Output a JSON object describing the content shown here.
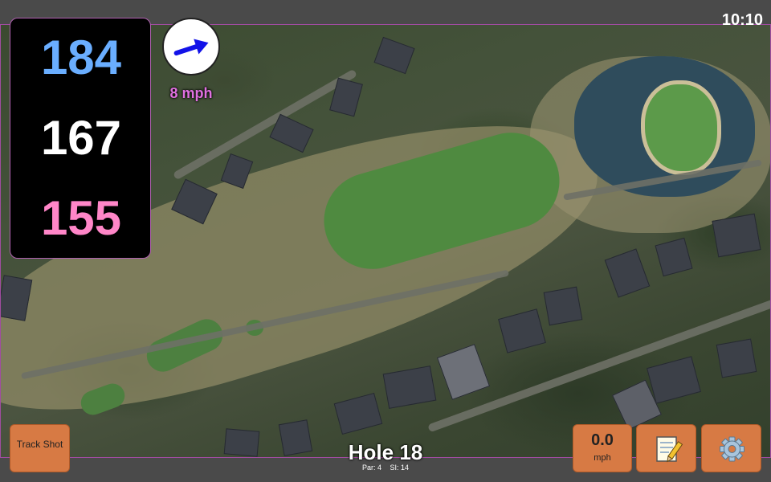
{
  "clock": "10:10",
  "yardages": {
    "back": "184",
    "middle": "167",
    "front": "155"
  },
  "wind": {
    "speed_label": "8 mph",
    "direction_icon": "arrow-right-icon"
  },
  "hole": {
    "title": "Hole 18",
    "par": "Par: 4",
    "stroke_index": "SI: 14"
  },
  "buttons": {
    "track_shot": "Track Shot",
    "wind_value": "0.0",
    "wind_unit": "mph",
    "notes_icon": "notepad-icon",
    "settings_icon": "gear-icon"
  },
  "colors": {
    "back_yardage": "#6aaeff",
    "middle_yardage": "#ffffff",
    "front_yardage": "#ff86c8",
    "wind_label": "#e070e0",
    "button_bg": "#d77a44"
  }
}
